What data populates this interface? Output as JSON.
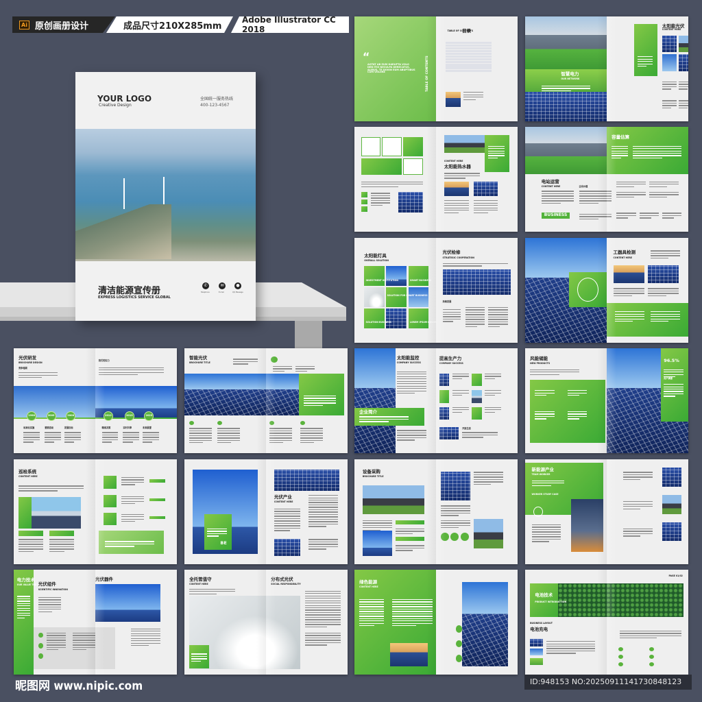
{
  "header": {
    "ai_badge": "Ai",
    "category": "原创画册设计",
    "size": "成品尺寸210X285mm",
    "software": "Adobe Illustrator CC 2018"
  },
  "cover": {
    "logo": "YOUR LOGO",
    "logo_sub": "Creative Design",
    "hotline_label": "全国统一服务热线",
    "hotline": "400-123-4567",
    "title": "清洁能源宣传册",
    "subtitle": "EXPRESS LOGISTICS SERVICE GLOBAL",
    "contacts": [
      {
        "icon": "phone-icon",
        "label": "Telephone"
      },
      {
        "icon": "email-icon",
        "label": "E-mail"
      },
      {
        "icon": "message-icon",
        "label": "QQ Message"
      }
    ]
  },
  "spreads": [
    {
      "texts": [
        "“",
        "AOTAT AB EUM HARUPTA VOLO DEB ITIO NECULPA DERECATUS. ALIBUS, TE DOION EUM ABUPTIBUS CUM VOLORE",
        "TABLE OF CONTENTS",
        "TABLE OF CONTENTS",
        "目录"
      ]
    },
    {
      "texts": [
        "智慧电力",
        "OUR NETWORK",
        "太阳能光伏",
        "CONTENT HERE"
      ]
    },
    {
      "texts": [
        "CONTENT HERE",
        "太阳能热水器"
      ]
    },
    {
      "texts": [
        "容量估算",
        "电站运营",
        "CONTENT HERE",
        "企业价值",
        "BUSINESS"
      ]
    },
    {
      "texts": [
        "太阳能灯具",
        "OVERALL SOLUTION",
        "INVESTMENT INSTITUTION",
        "SMART BUSINESS",
        "SOLUTION FOR SMART BUSINESS",
        "SOLUTION BUSINESS",
        "LOREM IPSUM DOLOR",
        "光伏检修",
        "STRATEGIC COOPERATION",
        "持续发展"
      ]
    },
    {
      "texts": [
        "工器具检测",
        "CONTENT HERE"
      ]
    },
    {
      "texts": [
        "光伏研发",
        "BROCHURE DESIGN",
        "竞争格局",
        "我们的实力",
        "1998",
        "2005",
        "2008",
        "2012",
        "2015",
        "2025",
        "标准化实施",
        "营销活动",
        "发展目标",
        "精准决策",
        "实时共享",
        "未来展望"
      ]
    },
    {
      "texts": [
        "智能光伏",
        "BROCHURE TITLE"
      ]
    },
    {
      "texts": [
        "太阳能监控",
        "COMPANY SUCCESS",
        "企业简介",
        "提高生产力",
        "COMPANY SUCCESS",
        "开放生态"
      ]
    },
    {
      "texts": [
        "风能储能",
        "NEW PRODUCTS",
        "96.5%",
        "用户满意"
      ]
    },
    {
      "texts": [
        "巡检系统",
        "CONTENT HERE"
      ]
    },
    {
      "texts": [
        "BE",
        "光伏产业",
        "CONTENT HERE"
      ]
    },
    {
      "texts": [
        "设备采购",
        "BROCHURE TITLE"
      ]
    },
    {
      "texts": [
        "新能源产业",
        "TEAM WORKER",
        "WORKER   STUDY   CASE"
      ]
    },
    {
      "texts": [
        "电力技术",
        "OUR VALUE THE COMPANY",
        "光伏组件",
        "SCIENTIFIC INNOVATION",
        "光伏器件"
      ]
    },
    {
      "texts": [
        "全托管值守",
        "CONTENT HERE",
        "分布式光伏",
        "SOCIAL RESPONSIBILITY"
      ]
    },
    {
      "texts": [
        "绿色能源",
        "CONTENT HERE"
      ]
    },
    {
      "texts": [
        "PAGE 01/02",
        "电池技术",
        "PRODUCT INTRODUCTION",
        "BUSINESS LAYOUT",
        "电池充电"
      ]
    }
  ],
  "footer": {
    "watermark": "昵图网 www.nipic.com",
    "id": "ID:948153 NO:20250911141730848123"
  }
}
